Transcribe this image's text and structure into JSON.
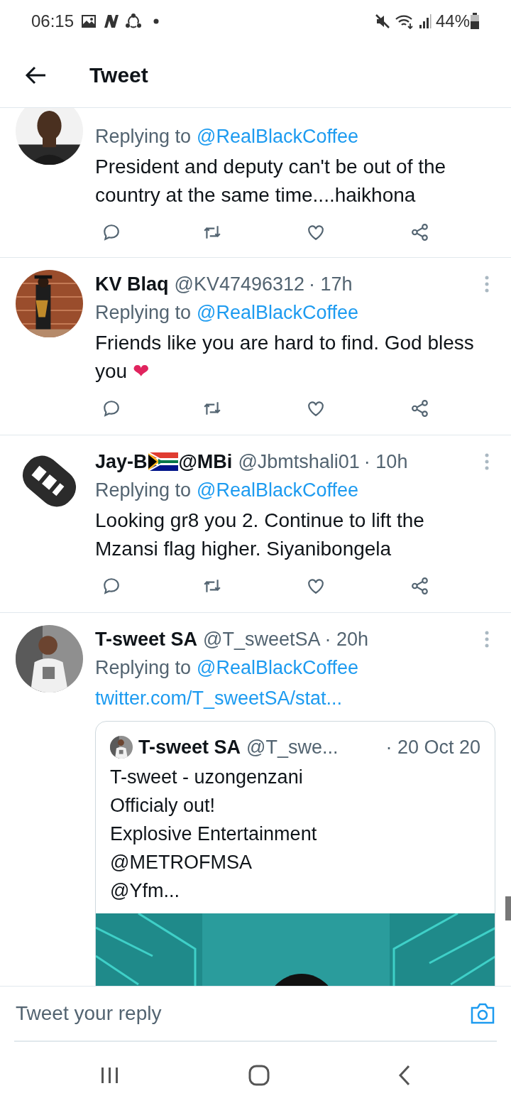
{
  "status_bar": {
    "time": "06:15",
    "battery": "44%"
  },
  "header": {
    "title": "Tweet"
  },
  "tweets": [
    {
      "kind": "cut",
      "replying_label": "Replying to",
      "replying_to": "@RealBlackCoffee",
      "body": [
        "President and deputy can't be out of the country at the same time....haikhona"
      ]
    },
    {
      "kind": "full",
      "name": [
        "KV Blaq"
      ],
      "handle": "@KV47496312",
      "time": "· 17h",
      "replying_label": "Replying to",
      "replying_to": "@RealBlackCoffee",
      "body": [
        "Friends like you are hard to find. God bless you"
      ],
      "emoji": "❤"
    },
    {
      "kind": "full",
      "name": [
        "Jay-B",
        "@MBi"
      ],
      "handle": "@Jbmtshali01",
      "time": "· 10h",
      "replying_label": "Replying to",
      "replying_to": "@RealBlackCoffee",
      "body": [
        "Looking gr8 you 2. Continue to lift the Mzansi flag higher. Siyanibongela"
      ]
    },
    {
      "kind": "quote",
      "name": [
        "T-sweet SA"
      ],
      "handle": "@T_sweetSA",
      "time": "· 20h",
      "replying_label": "Replying to",
      "replying_to": "@RealBlackCoffee",
      "link": "twitter.com/T_sweetSA/stat...",
      "quote": {
        "name": "T-sweet SA",
        "handle": "@T_swe...",
        "time": "· 20 Oct 20",
        "lines": [
          "T-sweet - uzongenzani",
          "Officialy out!",
          "Explosive Entertainment",
          "@METROFMSA",
          "@Yfm..."
        ]
      }
    }
  ],
  "reply_bar": {
    "placeholder": "Tweet your reply"
  }
}
